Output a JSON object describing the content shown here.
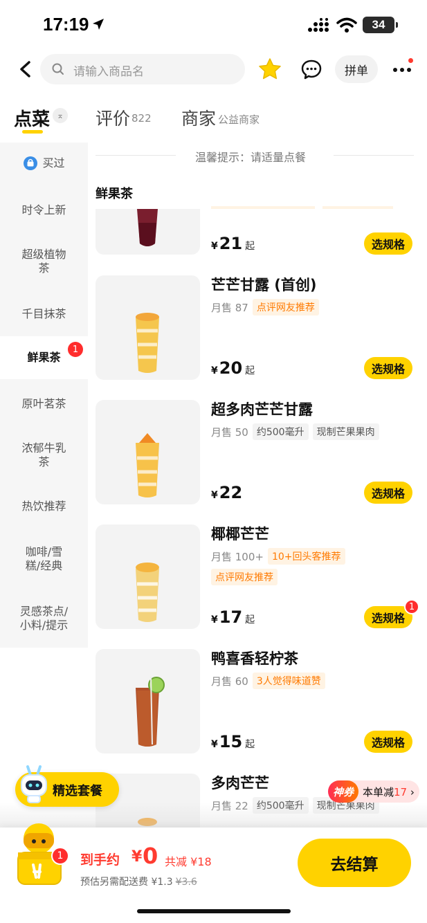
{
  "status_bar": {
    "time": "17:19",
    "battery": "34"
  },
  "top_nav": {
    "search_placeholder": "请输入商品名",
    "group_order_label": "拼单"
  },
  "tabs": {
    "order": "点菜",
    "review": "评价",
    "review_count": "822",
    "merchant": "商家",
    "merchant_sub": "公益商家"
  },
  "sidebar": {
    "items": [
      {
        "label": "买过"
      },
      {
        "label": "时令上新"
      },
      {
        "label": "超级植物茶"
      },
      {
        "label": "千目抹茶"
      },
      {
        "label": "鲜果茶",
        "active": true,
        "badge": "1"
      },
      {
        "label": "原叶茗茶"
      },
      {
        "label": "浓郁牛乳茶"
      },
      {
        "label": "热饮推荐"
      },
      {
        "label": "咖啡/雪糕/经典"
      },
      {
        "label": "灵感茶点/小料/提示"
      }
    ]
  },
  "tip": "温馨提示：请适量点餐",
  "section_title": "鲜果茶",
  "products": [
    {
      "name": "",
      "price_symbol": "¥",
      "price": "21",
      "suffix": "起",
      "button": "选规格"
    },
    {
      "name": "芒芒甘露 (首创)",
      "sold": "月售 87",
      "tags": [
        {
          "text": "点评网友推荐",
          "style": "orange"
        }
      ],
      "price_symbol": "¥",
      "price": "20",
      "suffix": "起",
      "button": "选规格"
    },
    {
      "name": "超多肉芒芒甘露",
      "sold": "月售 50",
      "tags": [
        {
          "text": "约500毫升",
          "style": "gray"
        },
        {
          "text": "现制芒果果肉",
          "style": "gray"
        }
      ],
      "price_symbol": "¥",
      "price": "22",
      "suffix": "",
      "button": "选规格"
    },
    {
      "name": "椰椰芒芒",
      "sold": "月售 100+",
      "tags": [
        {
          "text": "10+回头客推荐",
          "style": "orange"
        },
        {
          "text": "点评网友推荐",
          "style": "orange"
        }
      ],
      "price_symbol": "¥",
      "price": "17",
      "suffix": "起",
      "button": "选规格",
      "badge": "1"
    },
    {
      "name": "鸭喜香轻柠茶",
      "sold": "月售 60",
      "tags": [
        {
          "text": "3人觉得味道赞",
          "style": "orange"
        }
      ],
      "price_symbol": "¥",
      "price": "15",
      "suffix": "起",
      "button": "选规格"
    },
    {
      "name": "多肉芒芒",
      "sold": "月售 22",
      "tags": [
        {
          "text": "约500毫升",
          "style": "gray"
        },
        {
          "text": "现制芒果果肉",
          "style": "gray"
        }
      ]
    }
  ],
  "floating": {
    "combo_label": "精选套餐",
    "promo_brand": "神券",
    "promo_text": "本单减",
    "promo_amount": "17"
  },
  "cart": {
    "badge": "1",
    "total_label": "到手约",
    "total_symbol": "¥",
    "total_amount": "0",
    "saving": "共减 ¥18",
    "delivery_text": "预估另需配送费 ¥1.3",
    "delivery_original": "¥3.6",
    "checkout_label": "去结算"
  },
  "colors": {
    "accent": "#ffd200",
    "price_red": "#ff3b30",
    "tag_orange": "#ff7a00"
  }
}
